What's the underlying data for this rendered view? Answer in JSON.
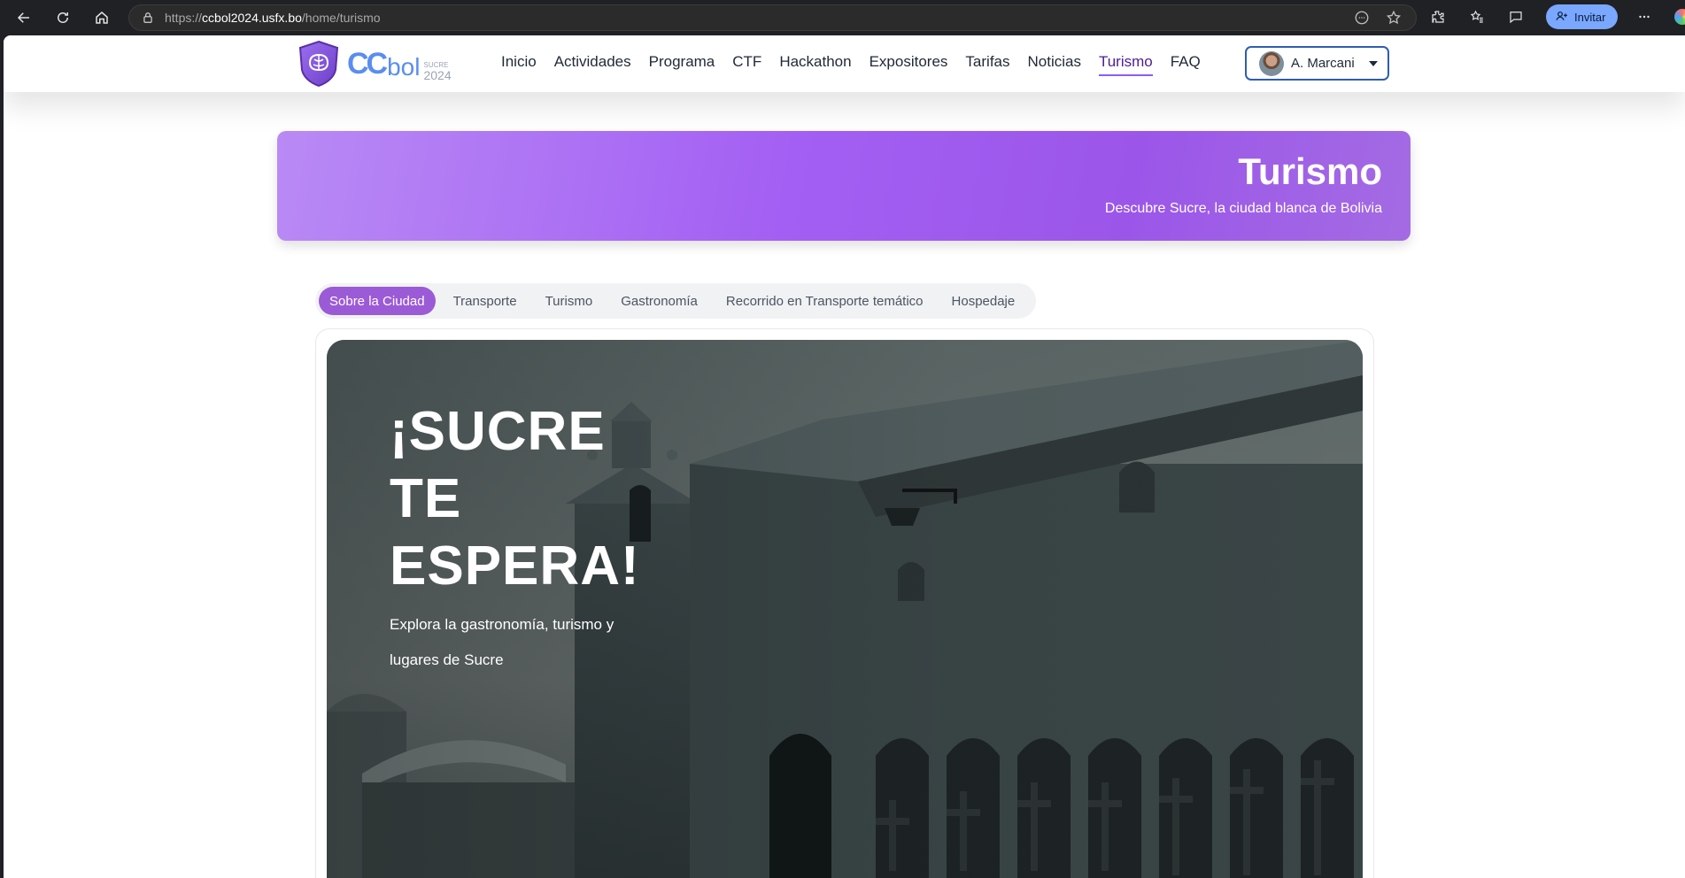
{
  "browser": {
    "url_prefix": "https://",
    "url_host": "ccbol2024.usfx.bo",
    "url_path": "/home/turismo",
    "invite_label": "Invitar"
  },
  "header": {
    "logo": {
      "cc": "CC",
      "bol": "bol",
      "sub_top": "SUCRE",
      "sub_year": "2024"
    },
    "nav": [
      {
        "label": "Inicio"
      },
      {
        "label": "Actividades"
      },
      {
        "label": "Programa"
      },
      {
        "label": "CTF"
      },
      {
        "label": "Hackathon"
      },
      {
        "label": "Expositores"
      },
      {
        "label": "Tarifas"
      },
      {
        "label": "Noticias"
      },
      {
        "label": "Turismo",
        "active": true
      },
      {
        "label": "FAQ"
      }
    ],
    "user_name": "A. Marcani"
  },
  "banner": {
    "title": "Turismo",
    "subtitle": "Descubre Sucre, la ciudad blanca de Bolivia"
  },
  "tabs": [
    {
      "label": "Sobre la Ciudad",
      "active": true
    },
    {
      "label": "Transporte"
    },
    {
      "label": "Turismo"
    },
    {
      "label": "Gastronomía"
    },
    {
      "label": "Recorrido en Transporte temático"
    },
    {
      "label": "Hospedaje"
    }
  ],
  "hero": {
    "title": "¡SUCRE TE ESPERA!",
    "description": "Explora la gastronomía, turismo y lugares de Sucre"
  },
  "colors": {
    "accent": "#9b5ad6",
    "banner_start": "#b98af5",
    "banner_end": "#9b56e9",
    "logo_blue": "#5a8df0",
    "user_border": "#2f5db0"
  }
}
